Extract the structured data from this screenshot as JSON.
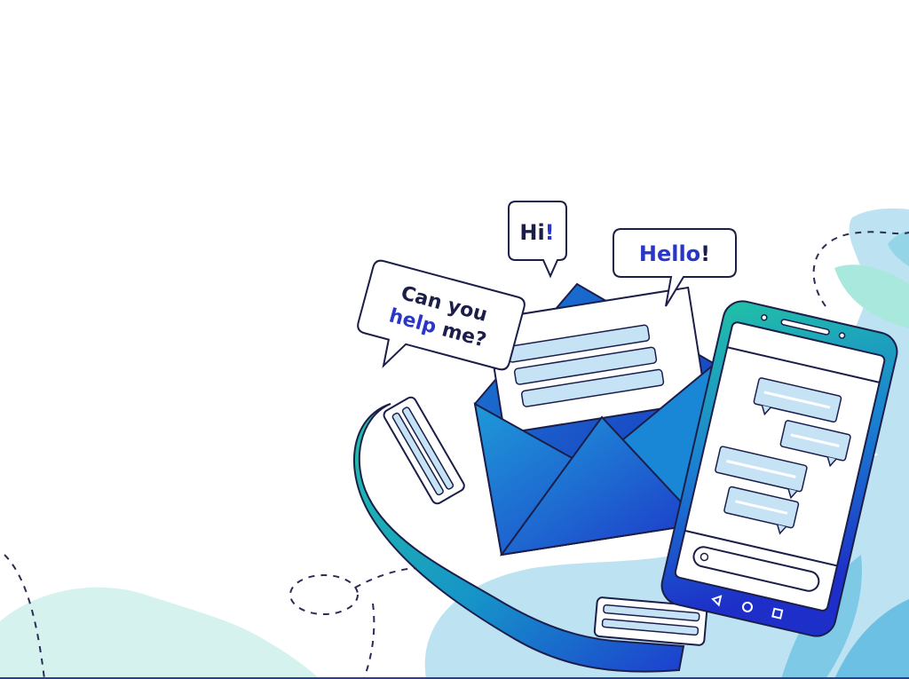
{
  "bubbles": {
    "hi": {
      "text": "Hi",
      "mark": "!"
    },
    "hello": {
      "text": "Hello",
      "mark": "!"
    },
    "help": {
      "line1": "Can you",
      "line2_accent": "help",
      "line2_rest": " me?"
    }
  },
  "colors": {
    "navy": "#1c1e4a",
    "accent_blue": "#2a36c9",
    "teal": "#1fbfa4",
    "royal_blue": "#1a3fd0",
    "blob_light_blue": "#bde3f3",
    "blob_mint": "#d5f2ef",
    "bottom_line": "#2f3d8f"
  },
  "icons": [
    "envelope-icon",
    "phone-handset-icon",
    "smartphone-icon",
    "speech-bubble-icon"
  ]
}
